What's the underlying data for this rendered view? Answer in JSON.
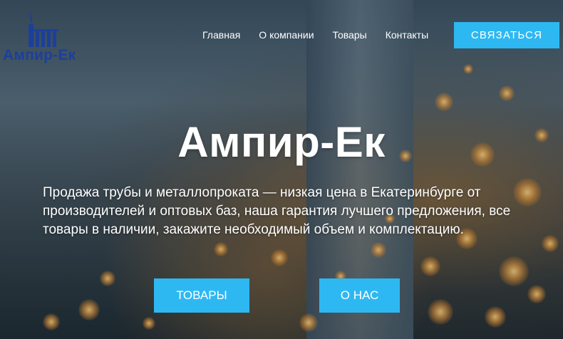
{
  "brand": {
    "name": "Ампир-Ек"
  },
  "nav": {
    "items": [
      "Главная",
      "О компании",
      "Товары",
      "Контакты"
    ],
    "contact_label": "СВЯЗАТЬСЯ"
  },
  "hero": {
    "title": "Ампир-Ек",
    "subtitle": "Продажа трубы и металлопроката — низкая цена в Екатеринбурге от производителей и оптовых баз, наша гарантия лучшего предложения, все товары в наличии, закажите необходимый объем и комплектацию.",
    "buttons": {
      "products": "ТОВАРЫ",
      "about": "О НАС"
    }
  },
  "colors": {
    "accent": "#2eb8f2",
    "logo": "#1d3f9a"
  }
}
